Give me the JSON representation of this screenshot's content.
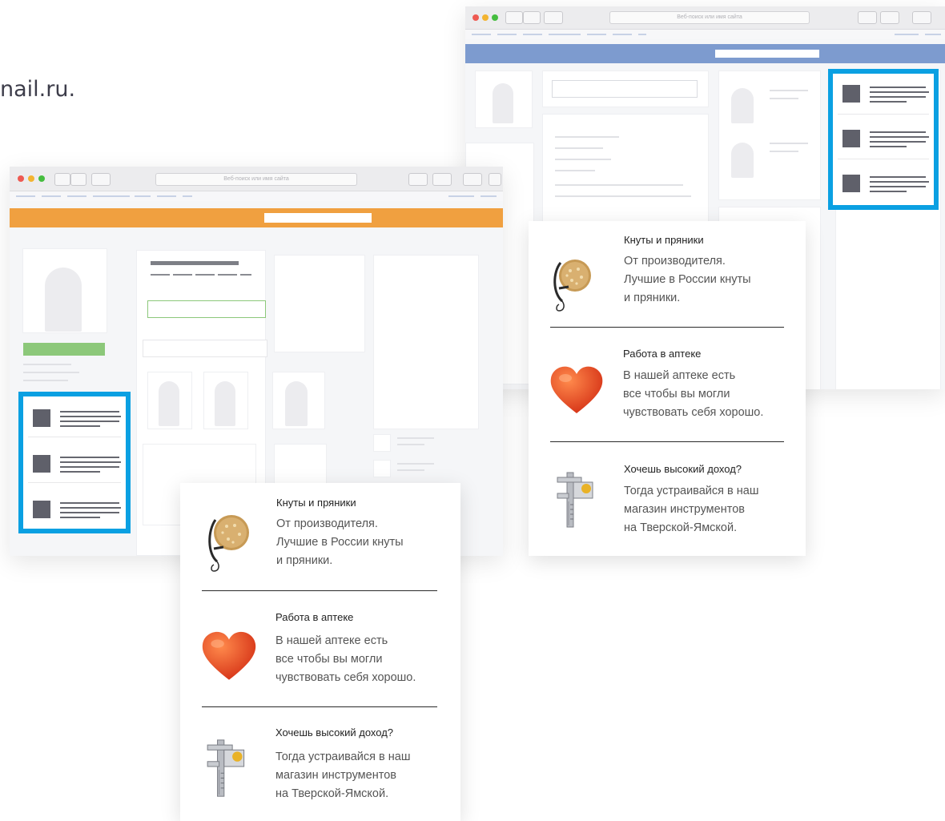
{
  "intro_text": "nail.ru.",
  "browser": {
    "address_placeholder": "Веб-поиск или имя сайта"
  },
  "colors": {
    "highlight": "#0aa0e2",
    "left_banner": "#f0a040",
    "right_banner": "#7d9bcf",
    "left_green_bar": "#8cc87a"
  },
  "ad_block": {
    "items": [
      {
        "title": "Кнуты и пряники",
        "lines": [
          "От производителя.",
          "Лучшие в России кнуты",
          "и пряники."
        ],
        "icon": "gingerbread-whip-icon"
      },
      {
        "title": "Работа в аптеке",
        "lines": [
          "В нашей аптеке есть",
          "все чтобы вы могли",
          "чувствовать себя  хорошо."
        ],
        "icon": "heart-icon"
      },
      {
        "title": "Хочешь высокий доход?",
        "lines": [
          "Тогда устраивайся в наш",
          "магазин инструментов",
          "на Тверской-Ямской."
        ],
        "icon": "caliper-icon"
      }
    ]
  }
}
